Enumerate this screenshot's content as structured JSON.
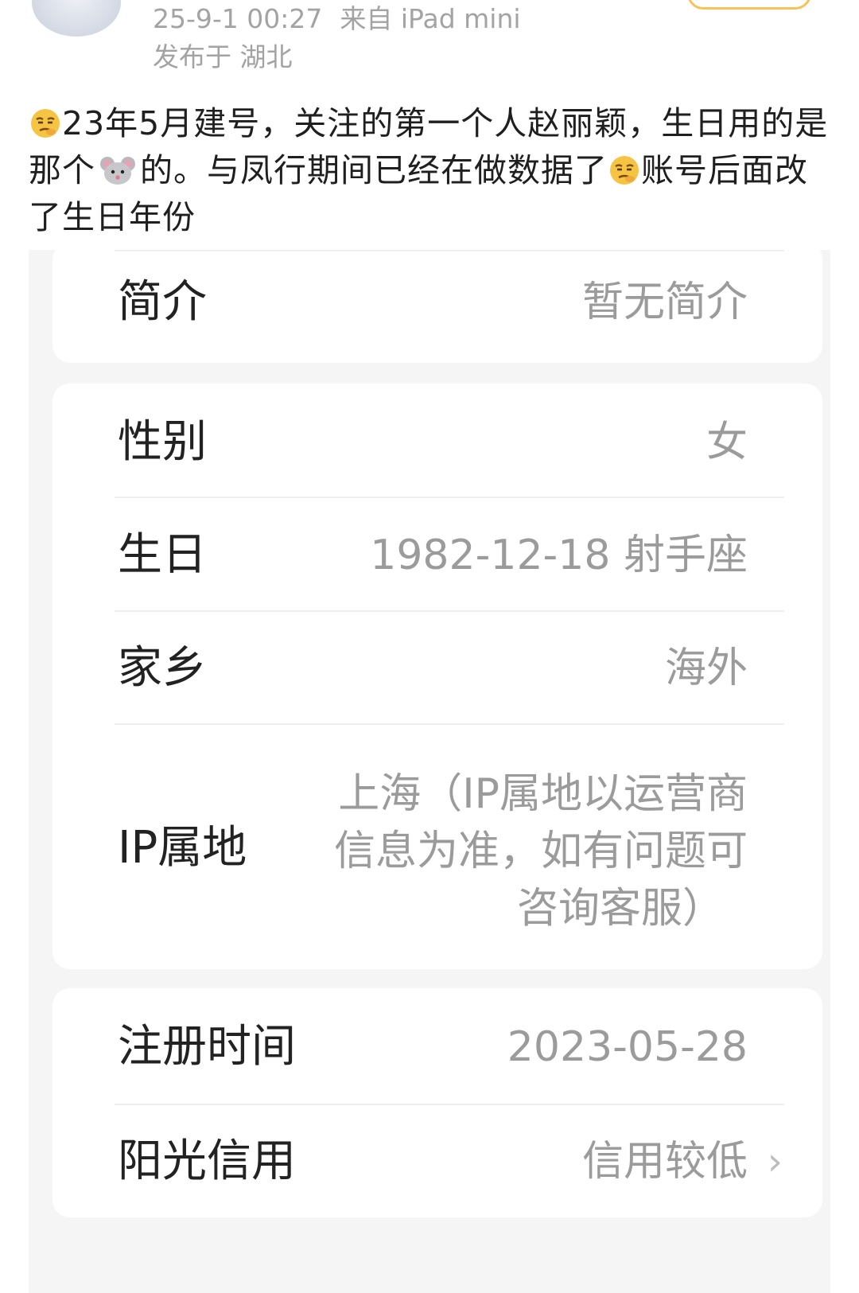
{
  "post": {
    "timestamp": "25-9-1 00:27",
    "source": "来自 iPad mini",
    "location": "发布于 湖北",
    "text_1": "23年5月建号，关注的第一个人赵丽颖，生日用的是那个",
    "text_2": "的。与凤行期间已经在做数据了",
    "text_3": "账号后面改了生日年份",
    "emojis": [
      "thinking-face-icon",
      "mouse-icon",
      "thinking-face-icon"
    ]
  },
  "profile": {
    "bio": {
      "label": "简介",
      "value": "暂无简介"
    },
    "gender": {
      "label": "性别",
      "value": "女"
    },
    "birthday": {
      "label": "生日",
      "value": "1982-12-18 射手座"
    },
    "hometown": {
      "label": "家乡",
      "value": "海外"
    },
    "ip": {
      "label": "IP属地",
      "value_line1": "上海（IP属地以运营商",
      "value_line2": "信息为准，如有问题可",
      "value_line3": "咨询客服）"
    },
    "register": {
      "label": "注册时间",
      "value": "2023-05-28"
    },
    "credit": {
      "label": "阳光信用",
      "value": "信用较低",
      "chevron": "›"
    }
  },
  "colors": {
    "label_text": "#222222",
    "value_text": "#9b9b9b",
    "card_bg": "#ffffff",
    "screen_bg": "#f5f5f5",
    "meta_text": "#a3a3a3",
    "follow_border": "#f4c35a"
  }
}
